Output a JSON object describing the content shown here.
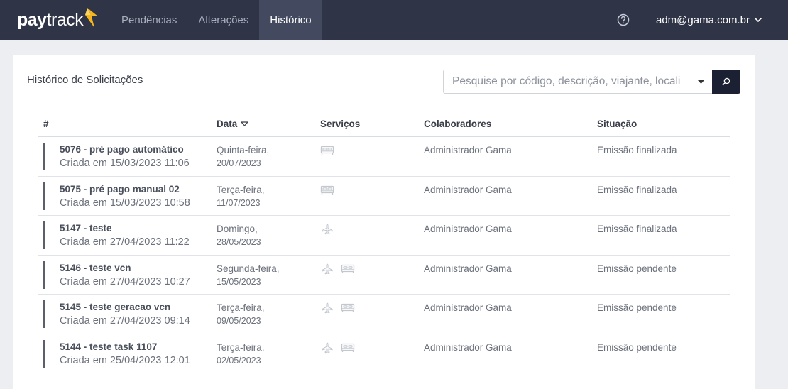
{
  "brand": {
    "logo_pay": "pay",
    "logo_track": "track",
    "accent": "#f5b51b"
  },
  "nav": {
    "items": [
      {
        "label": "Pendências",
        "active": false
      },
      {
        "label": "Alterações",
        "active": false
      },
      {
        "label": "Histórico",
        "active": true
      }
    ]
  },
  "user": {
    "email": "adm@gama.com.br"
  },
  "page": {
    "title": "Histórico de Solicitações",
    "search_placeholder": "Pesquise por código, descrição, viajante, localizador..."
  },
  "table": {
    "headers": {
      "hash": "#",
      "data": "Data",
      "servicos": "Serviços",
      "colaboradores": "Colaboradores",
      "situacao": "Situação"
    },
    "rows": [
      {
        "code": "5076 - pré pago automático",
        "created": "Criada em 15/03/2023 11:06",
        "weekday": "Quinta-feira,",
        "date": "20/07/2023",
        "services": [
          "bed-icon"
        ],
        "colab": "Administrador Gama",
        "status": "Emissão finalizada"
      },
      {
        "code": "5075 - pré pago manual 02",
        "created": "Criada em 15/03/2023 10:58",
        "weekday": "Terça-feira,",
        "date": "11/07/2023",
        "services": [
          "bed-icon"
        ],
        "colab": "Administrador Gama",
        "status": "Emissão finalizada"
      },
      {
        "code": "5147 - teste",
        "created": "Criada em 27/04/2023 11:22",
        "weekday": "Domingo,",
        "date": "28/05/2023",
        "services": [
          "plane-icon"
        ],
        "colab": "Administrador Gama",
        "status": "Emissão finalizada"
      },
      {
        "code": "5146 - teste vcn",
        "created": "Criada em 27/04/2023 10:27",
        "weekday": "Segunda-feira,",
        "date": "15/05/2023",
        "services": [
          "plane-icon",
          "bed-icon"
        ],
        "colab": "Administrador Gama",
        "status": "Emissão pendente"
      },
      {
        "code": "5145 - teste geracao vcn",
        "created": "Criada em 27/04/2023 09:14",
        "weekday": "Terça-feira,",
        "date": "09/05/2023",
        "services": [
          "plane-icon",
          "bed-icon"
        ],
        "colab": "Administrador Gama",
        "status": "Emissão pendente"
      },
      {
        "code": "5144 - teste task 1107",
        "created": "Criada em 25/04/2023 12:01",
        "weekday": "Terça-feira,",
        "date": "02/05/2023",
        "services": [
          "plane-icon",
          "bed-icon"
        ],
        "colab": "Administrador Gama",
        "status": "Emissão pendente"
      }
    ]
  }
}
